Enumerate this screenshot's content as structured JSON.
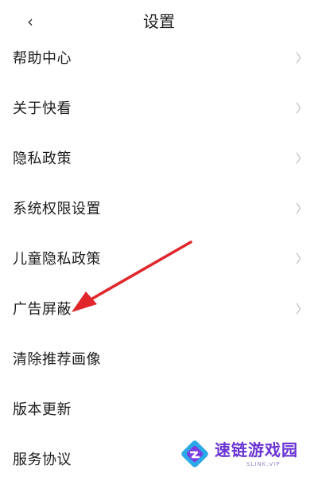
{
  "header": {
    "back_icon": "‹",
    "title": "设置"
  },
  "menu": {
    "chevron": "〉",
    "items": [
      {
        "label": "帮助中心"
      },
      {
        "label": "关于快看"
      },
      {
        "label": "隐私政策"
      },
      {
        "label": "系统权限设置"
      },
      {
        "label": "儿童隐私政策"
      },
      {
        "label": "广告屏蔽"
      },
      {
        "label": "清除推荐画像"
      },
      {
        "label": "版本更新"
      },
      {
        "label": "服务协议"
      }
    ]
  },
  "annotation": {
    "color": "#e0262b"
  },
  "watermark": {
    "title": "速链游戏园",
    "subtitle": "SLINK.VIP"
  },
  "colors": {
    "background": "#ffffff",
    "text": "#1c1c1c",
    "chevron": "#b6b6b6",
    "watermark": "#6a34d3"
  }
}
